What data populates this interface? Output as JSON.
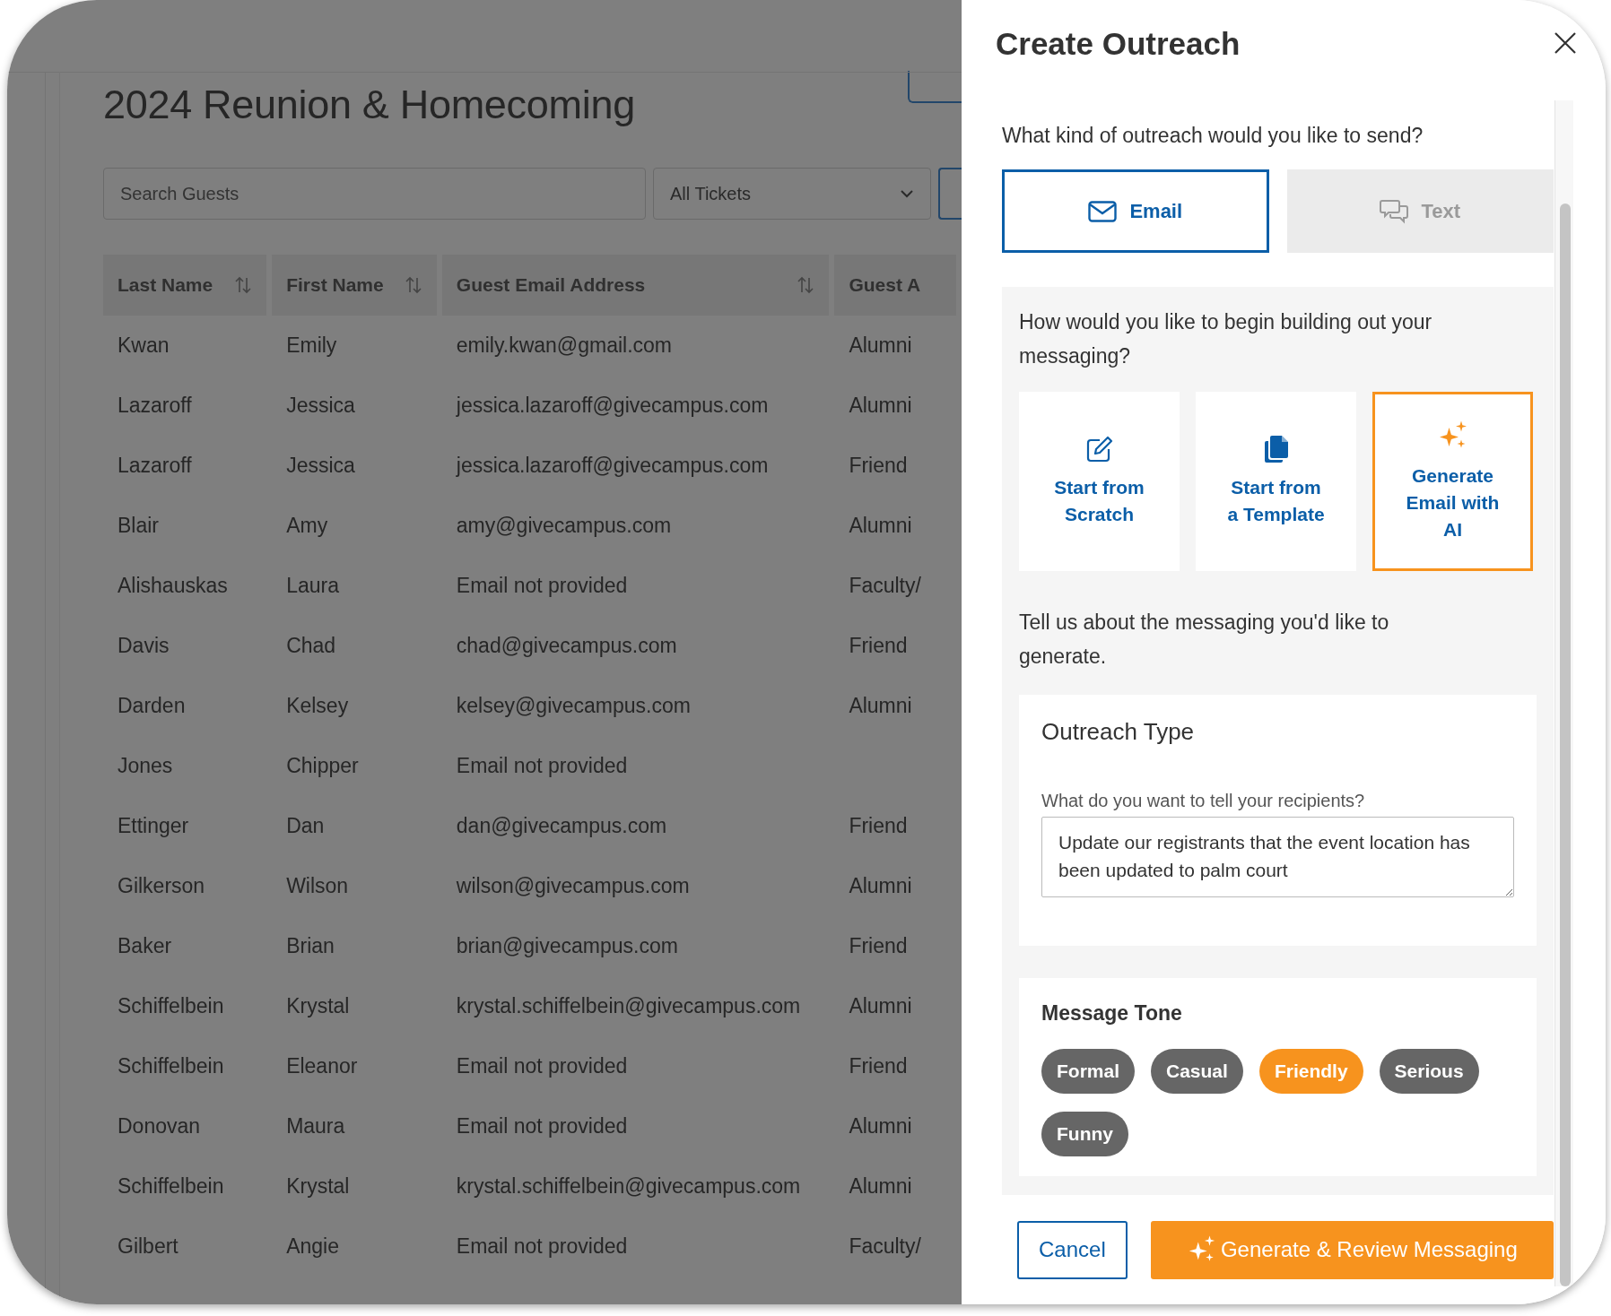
{
  "guest_page": {
    "title": "2024 Reunion & Homecoming",
    "search": {
      "placeholder": "Search Guests"
    },
    "ticket_filter": {
      "value": "All Tickets"
    },
    "table": {
      "columns": [
        {
          "label": "Last Name",
          "sortable": true
        },
        {
          "label": "First Name",
          "sortable": true
        },
        {
          "label": "Guest Email Address",
          "sortable": true
        },
        {
          "label": "Guest A",
          "sortable": false
        }
      ],
      "rows": [
        [
          "Kwan",
          "Emily",
          "emily.kwan@gmail.com",
          "Alumni"
        ],
        [
          "Lazaroff",
          "Jessica",
          "jessica.lazaroff@givecampus.com",
          "Alumni"
        ],
        [
          "Lazaroff",
          "Jessica",
          "jessica.lazaroff@givecampus.com",
          "Friend"
        ],
        [
          "Blair",
          "Amy",
          "amy@givecampus.com",
          "Alumni"
        ],
        [
          "Alishauskas",
          "Laura",
          "Email not provided",
          "Faculty/"
        ],
        [
          "Davis",
          "Chad",
          "chad@givecampus.com",
          "Friend"
        ],
        [
          "Darden",
          "Kelsey",
          "kelsey@givecampus.com",
          "Alumni"
        ],
        [
          "Jones",
          "Chipper",
          "Email not provided",
          ""
        ],
        [
          "Ettinger",
          "Dan",
          "dan@givecampus.com",
          "Friend"
        ],
        [
          "Gilkerson",
          "Wilson",
          "wilson@givecampus.com",
          "Alumni"
        ],
        [
          "Baker",
          "Brian",
          "brian@givecampus.com",
          "Friend"
        ],
        [
          "Schiffelbein",
          "Krystal",
          "krystal.schiffelbein@givecampus.com",
          "Alumni"
        ],
        [
          "Schiffelbein",
          "Eleanor",
          "Email not provided",
          "Friend"
        ],
        [
          "Donovan",
          "Maura",
          "Email not provided",
          "Alumni"
        ],
        [
          "Schiffelbein",
          "Krystal",
          "krystal.schiffelbein@givecampus.com",
          "Alumni"
        ],
        [
          "Gilbert",
          "Angie",
          "Email not provided",
          "Faculty/"
        ]
      ]
    }
  },
  "panel": {
    "title": "Create Outreach",
    "channel_question": "What kind of outreach would you like to send?",
    "channels": [
      {
        "kind": "email",
        "label": "Email",
        "selected": true
      },
      {
        "kind": "text",
        "label": "Text",
        "selected": false
      }
    ],
    "build_question": "How would you like to begin building out your messaging?",
    "build_options": [
      {
        "kind": "scratch",
        "label_lines": [
          "Start from",
          "Scratch"
        ],
        "selected": false
      },
      {
        "kind": "template",
        "label_lines": [
          "Start from",
          "a Template"
        ],
        "selected": false
      },
      {
        "kind": "ai",
        "label_lines": [
          "Generate",
          "Email with",
          "AI"
        ],
        "selected": true
      }
    ],
    "generate_prompt": "Tell us about the messaging you'd like to generate.",
    "outreach_type": {
      "heading": "Outreach Type",
      "label": "What do you want to tell your recipients?",
      "value": "Update our registrants that the event location has been updated to palm court"
    },
    "message_tone": {
      "heading": "Message Tone",
      "tones": [
        {
          "label": "Formal",
          "selected": false
        },
        {
          "label": "Casual",
          "selected": false
        },
        {
          "label": "Friendly",
          "selected": true
        },
        {
          "label": "Serious",
          "selected": false
        },
        {
          "label": "Funny",
          "selected": false
        }
      ]
    },
    "buttons": [
      {
        "kind": "secondary",
        "label": "Cancel"
      },
      {
        "kind": "primary",
        "label": "Generate & Review Messaging"
      }
    ]
  }
}
